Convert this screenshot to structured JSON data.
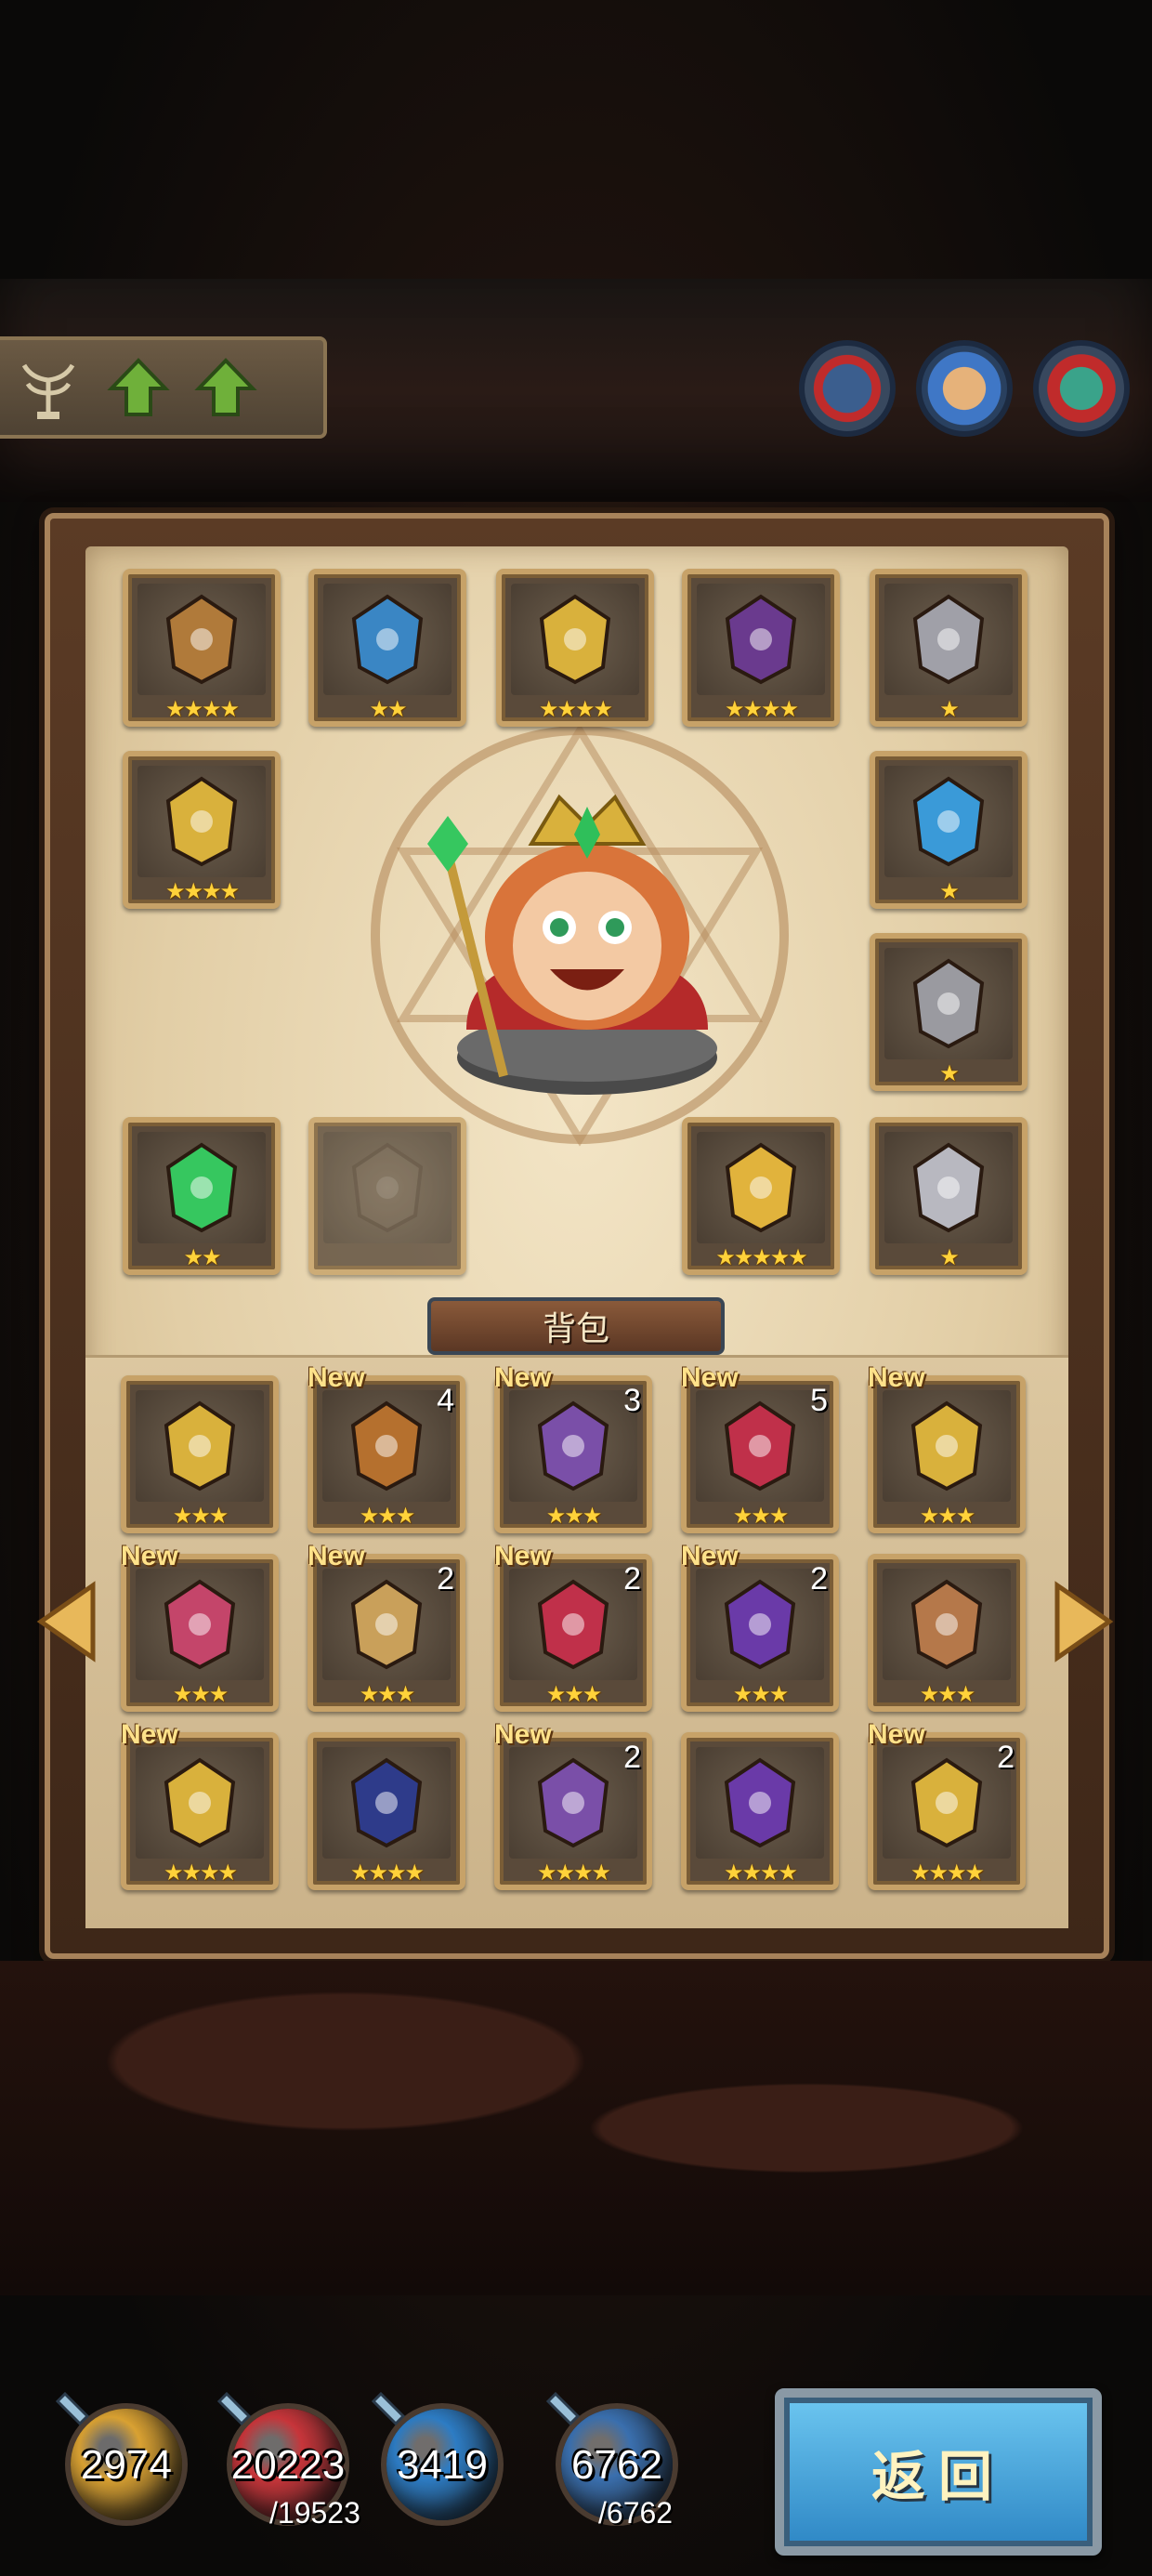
{
  "header": {
    "upgrade_icons": [
      "tree-icon",
      "arrow-up-icon",
      "arrow-up-icon"
    ],
    "portraits": [
      "hero-portrait-1",
      "hero-portrait-2",
      "hero-portrait-3"
    ]
  },
  "equipped": [
    {
      "name": "gauntlet",
      "stars": "★★★★"
    },
    {
      "name": "chest-armor",
      "stars": "★★"
    },
    {
      "name": "horned-helmet",
      "stars": "★★★★"
    },
    {
      "name": "dark-lantern",
      "stars": "★★★★"
    },
    {
      "name": "silver-necklace",
      "stars": "★"
    },
    {
      "name": "gold-shoulder-armor",
      "stars": "★★★★"
    },
    {
      "name": "blue-gem-ring",
      "stars": "★"
    },
    {
      "name": "silver-cape",
      "stars": "★"
    },
    {
      "name": "emerald-scepter",
      "stars": "★★"
    },
    {
      "name": "empty-slot",
      "stars": ""
    },
    {
      "name": "golden-tome",
      "stars": "★★★★★"
    },
    {
      "name": "iron-boots",
      "stars": "★"
    }
  ],
  "backpack": {
    "title": "背包",
    "items": [
      {
        "name": "gold-bracer",
        "stars": "★★★",
        "new": "",
        "count": ""
      },
      {
        "name": "copper-circlet",
        "stars": "★★★",
        "new": "New",
        "count": "4"
      },
      {
        "name": "purple-pendant",
        "stars": "★★★",
        "new": "New",
        "count": "3"
      },
      {
        "name": "ruby-ring",
        "stars": "★★★",
        "new": "New",
        "count": "5"
      },
      {
        "name": "amethyst-ring",
        "stars": "★★★",
        "new": "New",
        "count": ""
      },
      {
        "name": "pink-boots",
        "stars": "★★★",
        "new": "New",
        "count": ""
      },
      {
        "name": "gold-greaves",
        "stars": "★★★",
        "new": "New",
        "count": "2"
      },
      {
        "name": "crimson-hood",
        "stars": "★★★",
        "new": "New",
        "count": "2"
      },
      {
        "name": "violet-cloak",
        "stars": "★★★",
        "new": "New",
        "count": "2"
      },
      {
        "name": "rune-stone",
        "stars": "★★★",
        "new": "",
        "count": ""
      },
      {
        "name": "gold-pauldron",
        "stars": "★★★★",
        "new": "New",
        "count": ""
      },
      {
        "name": "crystal-necklace",
        "stars": "★★★★",
        "new": "",
        "count": ""
      },
      {
        "name": "amethyst-necklace",
        "stars": "★★★★",
        "new": "New",
        "count": "2"
      },
      {
        "name": "dragon-ring",
        "stars": "★★★★",
        "new": "",
        "count": ""
      },
      {
        "name": "royal-boots",
        "stars": "★★★★",
        "new": "New",
        "count": "2"
      }
    ]
  },
  "resources": [
    {
      "name": "gold-potion",
      "value": "2974",
      "max": "",
      "color": "#d9a132"
    },
    {
      "name": "red-potion",
      "value": "20223",
      "max": "/19523",
      "color": "#c7353a"
    },
    {
      "name": "blue-potion",
      "value": "3419",
      "max": "",
      "color": "#2d7cc4"
    },
    {
      "name": "mana-potion",
      "value": "6762",
      "max": "/6762",
      "color": "#3a6fae"
    }
  ],
  "return_label": "返回",
  "colors": {
    "slot_border": "#c7a268",
    "star": "#ffd23a",
    "return_button": "#3f9ad8"
  }
}
